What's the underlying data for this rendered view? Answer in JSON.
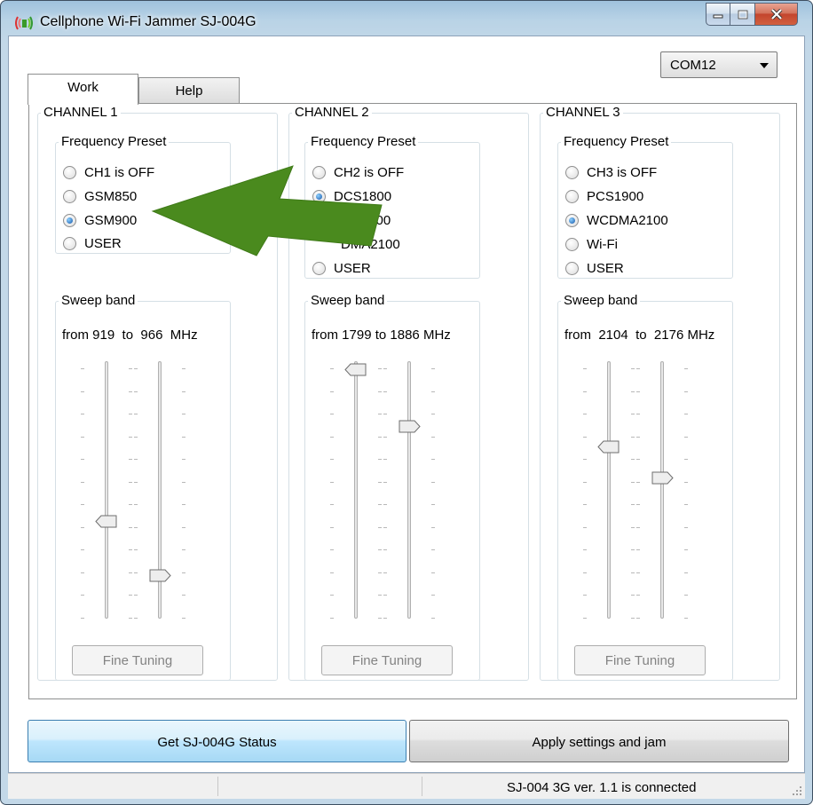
{
  "window": {
    "title": "Cellphone Wi-Fi Jammer SJ-004G"
  },
  "port_select": {
    "value": "COM12"
  },
  "tabs": [
    {
      "label": "Work"
    },
    {
      "label": "Help"
    }
  ],
  "channels": [
    {
      "title": "CHANNEL 1",
      "preset_group_label": "Frequency Preset",
      "presets": [
        {
          "label": "CH1 is OFF",
          "selected": false
        },
        {
          "label": "GSM850",
          "selected": false
        },
        {
          "label": "GSM900",
          "selected": true
        },
        {
          "label": "USER",
          "selected": false
        }
      ],
      "sweep_label": "Sweep band",
      "from_label": "from",
      "to_label": "to",
      "from_mhz": "919",
      "to_mhz": "966",
      "unit": "MHz",
      "fine_tuning_label": "Fine Tuning"
    },
    {
      "title": "CHANNEL 2",
      "preset_group_label": "Frequency Preset",
      "presets": [
        {
          "label": "CH2 is OFF",
          "selected": false
        },
        {
          "label": "DCS1800",
          "selected": true
        },
        {
          "label": "PCS1900",
          "selected": false
        },
        {
          "label": "DMA2100",
          "selected": false
        },
        {
          "label": "USER",
          "selected": false
        }
      ],
      "sweep_label": "Sweep band",
      "from_label": "from",
      "to_label": "to",
      "from_mhz": "1799",
      "to_mhz": "1886",
      "unit": "MHz",
      "fine_tuning_label": "Fine Tuning"
    },
    {
      "title": "CHANNEL 3",
      "preset_group_label": "Frequency Preset",
      "presets": [
        {
          "label": "CH3 is OFF",
          "selected": false
        },
        {
          "label": "PCS1900",
          "selected": false
        },
        {
          "label": "WCDMA2100",
          "selected": true
        },
        {
          "label": "Wi-Fi",
          "selected": false
        },
        {
          "label": "USER",
          "selected": false
        }
      ],
      "sweep_label": "Sweep band",
      "from_label": "from",
      "to_label": "to",
      "from_mhz": "2104",
      "to_mhz": "2176",
      "unit": "MHz",
      "fine_tuning_label": "Fine Tuning"
    }
  ],
  "actions": {
    "status_label": "Get SJ-004G Status",
    "apply_label": "Apply settings and jam"
  },
  "statusbar": {
    "text": "SJ-004 3G ver. 1.1 is connected"
  },
  "colors": {
    "arrow": "#4a8a1e",
    "selected_radio": "#1556a8",
    "title_bar": "#b9d3e6"
  }
}
